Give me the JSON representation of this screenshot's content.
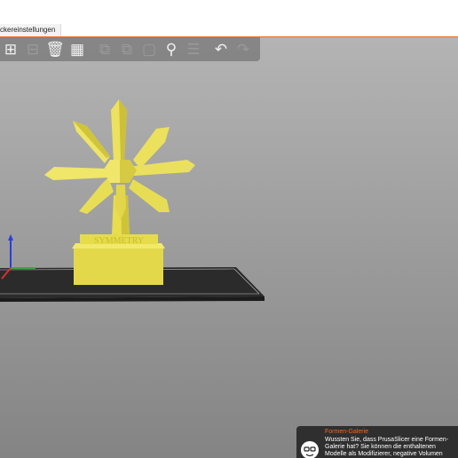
{
  "tab": {
    "label": "ckereinstellungen"
  },
  "toolbar": {
    "buttons": [
      {
        "name": "add-icon",
        "state": "enabled"
      },
      {
        "name": "delete-icon",
        "state": "disabled"
      },
      {
        "name": "delete-all-icon",
        "state": "enabled"
      },
      {
        "name": "arrange-icon",
        "state": "enabled"
      },
      {
        "name": "copy-icon",
        "state": "disabled"
      },
      {
        "name": "paste-icon",
        "state": "disabled"
      },
      {
        "name": "add-instance-icon",
        "state": "disabled"
      },
      {
        "name": "search-icon",
        "state": "enabled"
      },
      {
        "name": "layers-icon",
        "state": "disabled"
      },
      {
        "name": "undo-icon",
        "state": "enabled"
      },
      {
        "name": "redo-icon",
        "state": "disabled"
      }
    ]
  },
  "model": {
    "base_text": "SYMMETRY",
    "color": "#e6dc4a"
  },
  "hint": {
    "title": "Formen-Galerie",
    "text": "Wussten Sie, dass PrusaSlicer eine Formen-Galerie hat? Sie können die enthaltenen Modelle als Modifizierer, negative Volumen oder als druckbare"
  },
  "colors": {
    "accent": "#ed6b21",
    "bed": "#2b2b2b",
    "model": "#e6dc4a"
  }
}
